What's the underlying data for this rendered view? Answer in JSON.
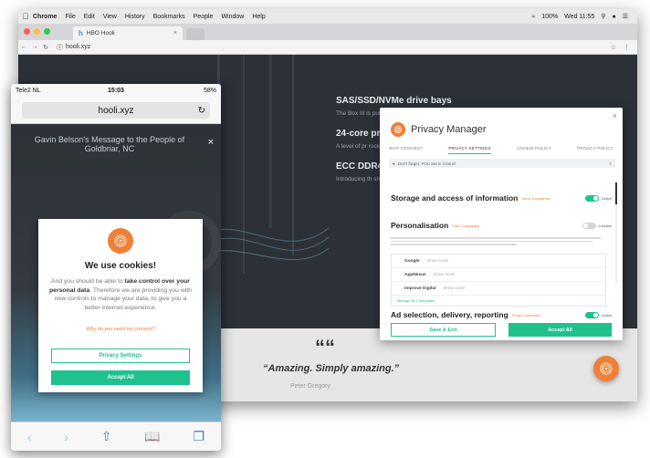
{
  "desktop": {
    "menubar": {
      "app": "Chrome",
      "items": [
        "File",
        "Edit",
        "View",
        "History",
        "Bookmarks",
        "People",
        "Window",
        "Help"
      ],
      "battery": "100%",
      "clock": "Wed 11:55"
    },
    "tab": {
      "favicon": "h",
      "title": "HBO Hooli"
    },
    "address": {
      "url": "hooli.xyz"
    },
    "features": [
      {
        "title": "SAS/SSD/NVMe drive bays",
        "text": "The Box III is pushing the limit for performance and reliability. Welcome to advanced computing."
      },
      {
        "title": "24-core pr",
        "text": "A level of pr rocket speed."
      },
      {
        "title": "ECC DDR4",
        "text": "Introducing th shouldn't be el"
      }
    ],
    "quote": {
      "mark": "““",
      "text": "“Amazing. Simply amazing.”",
      "author": "Peter Gregory"
    }
  },
  "privacy_manager": {
    "title": "Privacy Manager",
    "close": "×",
    "tabs": [
      "WHY COOKIES?",
      "PRIVACY SETTINGS",
      "COOKIE POLICY",
      "PRIVACY POLICY"
    ],
    "notice": "Don't forget, YOU are in control!",
    "sections": [
      {
        "title": "Storage and access of information",
        "sub": "Show Companies",
        "toggle_label": "Active",
        "state": "on"
      },
      {
        "title": "Personalisation",
        "sub": "Hide Companies",
        "toggle_label": "Inactive",
        "state": "off"
      },
      {
        "title": "Ad selection, delivery, reporting",
        "sub": "Show Companies",
        "toggle_label": "Active",
        "state": "on"
      }
    ],
    "vendors": [
      {
        "name": "Google",
        "meta": "show more"
      },
      {
        "name": "AppNexus",
        "meta": "show more"
      },
      {
        "name": "Improve Digital",
        "meta": "show more"
      }
    ],
    "manage_link": "Manage All Companies",
    "save_button": "Save & Exit",
    "accept_button": "Accept All"
  },
  "phone": {
    "carrier": "Tele2 NL",
    "time": "15:03",
    "battery": "58%",
    "url": "hooli.xyz",
    "reload": "↻",
    "headline": "Gavin Belson's Message to the People of Goldbriar, NC",
    "close": "×",
    "cookie": {
      "title": "We use cookies!",
      "body_pre": "And you should be able to ",
      "body_bold": "take control over your personal data",
      "body_post": ". Therefore we are providing you with new controls to manage your data, to give you a better internet experience.",
      "link": "Why do you need my consent?",
      "settings_button": "Privacy Settings",
      "accept_button": "Accept All"
    }
  },
  "colors": {
    "accent": "#1fc28c",
    "brand": "#f07f37"
  }
}
